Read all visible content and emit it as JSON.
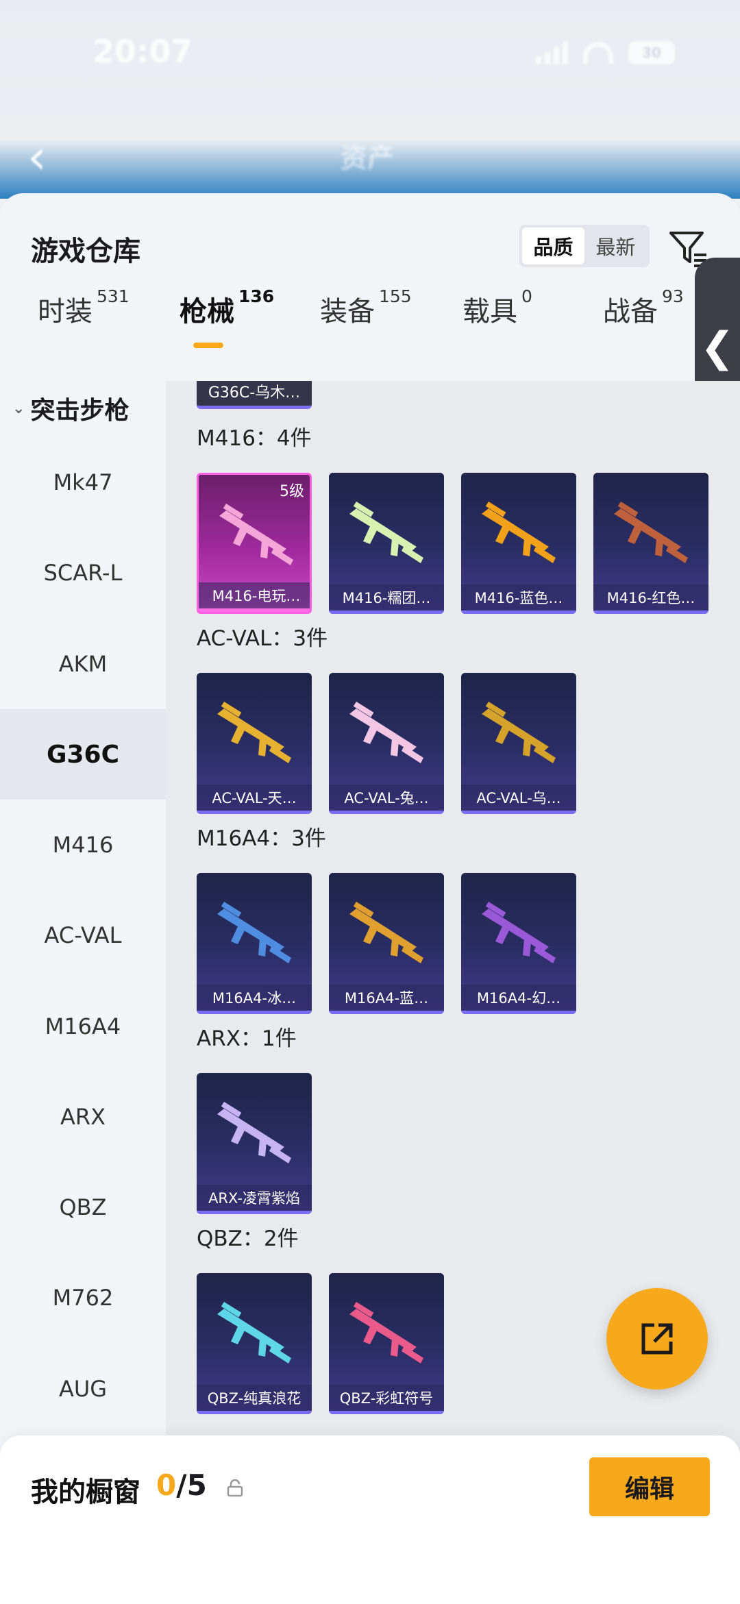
{
  "status_bar": {
    "time": "20:07",
    "battery": "30"
  },
  "nav": {
    "title": "资产"
  },
  "sheet": {
    "title": "游戏仓库",
    "sort": {
      "options": [
        "品质",
        "最新"
      ],
      "selected": "品质"
    }
  },
  "tabs": [
    {
      "label": "时装",
      "count": "531"
    },
    {
      "label": "枪械",
      "count": "136",
      "active": true
    },
    {
      "label": "装备",
      "count": "155"
    },
    {
      "label": "载具",
      "count": "0"
    },
    {
      "label": "战备",
      "count": "93"
    }
  ],
  "sidebar": {
    "category": "突击步枪",
    "items": [
      "Mk47",
      "SCAR-L",
      "AKM",
      "G36C",
      "M416",
      "AC-VAL",
      "M16A4",
      "ARX",
      "QBZ",
      "M762",
      "AUG"
    ],
    "selected": "G36C"
  },
  "content": {
    "prev_item": "G36C-乌木…",
    "groups": [
      {
        "title": "M416：4件",
        "items": [
          {
            "name": "M416-电玩…",
            "level": "5级",
            "rarity": "legendary",
            "color": "#f4a6d8"
          },
          {
            "name": "M416-糯团…",
            "rarity": "epic",
            "color": "#d8f0b0"
          },
          {
            "name": "M416-蓝色…",
            "rarity": "epic",
            "color": "#f2a21a"
          },
          {
            "name": "M416-红色…",
            "rarity": "epic",
            "color": "#c0613d"
          }
        ]
      },
      {
        "title": "AC-VAL：3件",
        "items": [
          {
            "name": "AC-VAL-天…",
            "rarity": "epic",
            "color": "#e6b030"
          },
          {
            "name": "AC-VAL-兔…",
            "rarity": "epic",
            "color": "#f3c6e4"
          },
          {
            "name": "AC-VAL-乌…",
            "rarity": "epic",
            "color": "#d6a32a"
          }
        ]
      },
      {
        "title": "M16A4：3件",
        "items": [
          {
            "name": "M16A4-冰…",
            "rarity": "epic",
            "color": "#4f8de0"
          },
          {
            "name": "M16A4-蓝…",
            "rarity": "epic",
            "color": "#e0a030"
          },
          {
            "name": "M16A4-幻…",
            "rarity": "epic",
            "color": "#9a5ad8"
          }
        ]
      },
      {
        "title": "ARX：1件",
        "items": [
          {
            "name": "ARX-凌霄紫焰",
            "rarity": "epic",
            "color": "#c6b3f2"
          }
        ]
      },
      {
        "title": "QBZ：2件",
        "items": [
          {
            "name": "QBZ-纯真浪花",
            "rarity": "epic",
            "color": "#5fd6e8"
          },
          {
            "name": "QBZ-彩虹符号",
            "rarity": "epic",
            "color": "#ea5a8a"
          }
        ]
      }
    ]
  },
  "bottom": {
    "label": "我的橱窗",
    "current": "0",
    "total": "/5",
    "edit_label": "编辑"
  },
  "colors": {
    "accent": "#f7a81b",
    "card_bg": "#2a2e66",
    "legendary_bg": "#a02a9d"
  },
  "icons": [
    "back-icon",
    "filter-icon",
    "chevron-left-icon",
    "chevron-down-icon",
    "share-icon",
    "lock-icon"
  ]
}
